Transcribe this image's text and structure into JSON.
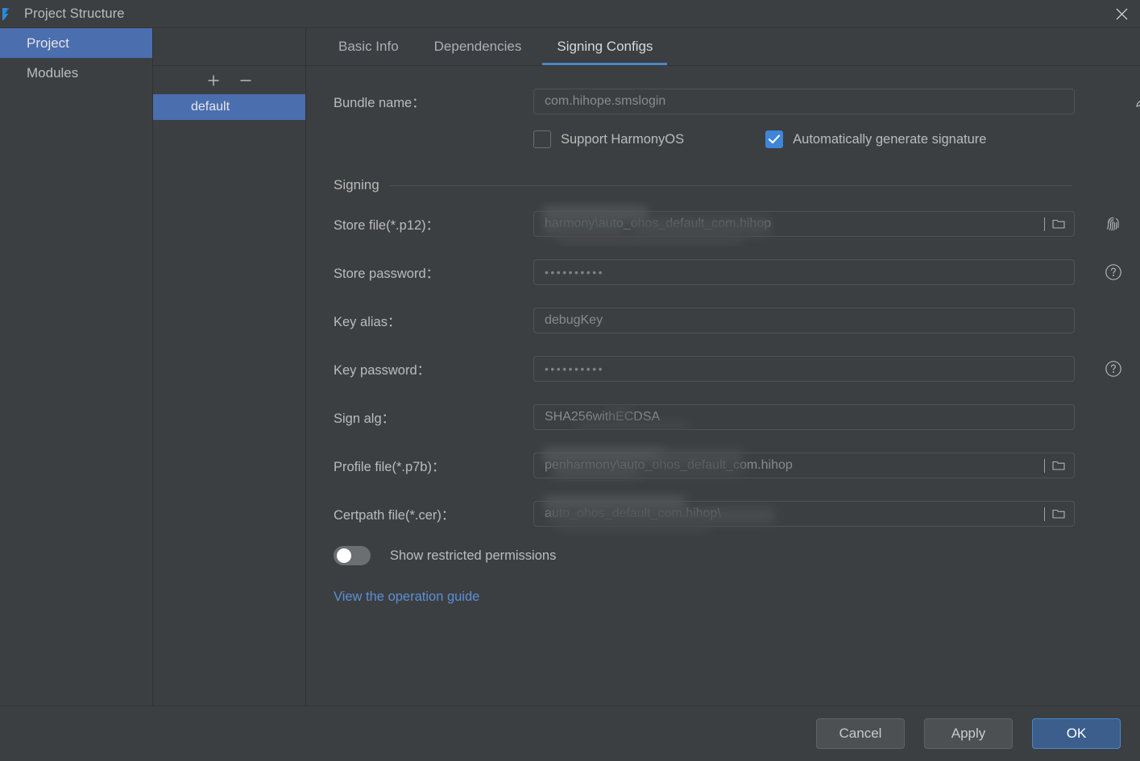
{
  "window": {
    "title": "Project Structure",
    "app_icon": "deveco-logo-icon",
    "close_icon": "close-icon"
  },
  "leftnav": {
    "items": [
      {
        "label": "Project",
        "selected": true
      },
      {
        "label": "Modules",
        "selected": false
      }
    ]
  },
  "tabs": [
    {
      "label": "Basic Info",
      "active": false
    },
    {
      "label": "Dependencies",
      "active": false
    },
    {
      "label": "Signing Configs",
      "active": true
    }
  ],
  "configs_panel": {
    "add_label": "+",
    "remove_label": "−",
    "items": [
      {
        "label": "default",
        "selected": true
      }
    ]
  },
  "form": {
    "bundle_name": {
      "label": "Bundle name：",
      "value": "com.hihope.smslogin",
      "edit_icon": "pencil-edit-icon"
    },
    "checkboxes": [
      {
        "label": "Support HarmonyOS",
        "checked": false
      },
      {
        "label": "Automatically generate signature",
        "checked": true
      }
    ],
    "section_title": "Signing",
    "fields": [
      {
        "label": "Store file(*.p12)：",
        "value": "harmony\\auto_ohos_default_com.hihop",
        "redacted": true,
        "browse_icon": "folder-browse-icon",
        "side_icon": "fingerprint-icon"
      },
      {
        "label": "Store password：",
        "value": "••••••••••",
        "masked": true,
        "side_icon": "help-circle-icon"
      },
      {
        "label": "Key alias：",
        "value": "debugKey"
      },
      {
        "label": "Key password：",
        "value": "••••••••••",
        "masked": true,
        "side_icon": "help-circle-icon"
      },
      {
        "label": "Sign alg：",
        "value": "SHA256withECDSA"
      },
      {
        "label": "Profile file(*.p7b)：",
        "value": "penharmony\\auto_ohos_default_com.hihop",
        "redacted": true,
        "browse_icon": "folder-browse-icon"
      },
      {
        "label": "Certpath file(*.cer)：",
        "value": "\\auto_ohos_default_com.hihop",
        "redacted": true,
        "browse_icon": "folder-browse-icon"
      }
    ],
    "toggle": {
      "label": "Show restricted permissions",
      "on": false
    },
    "guide_link": "View the operation guide"
  },
  "footer": {
    "cancel_label": "Cancel",
    "apply_label": "Apply",
    "ok_label": "OK"
  },
  "colors": {
    "window_bg": "#3c3f41",
    "selection_blue": "#4b6eaf",
    "accent_blue": "#4a88c7",
    "link_blue": "#5b8fd6",
    "checkbox_blue": "#3d86d8",
    "primary_button": "#3b5e8c",
    "text": "#bbbbbb",
    "muted_text": "#878b8d"
  }
}
